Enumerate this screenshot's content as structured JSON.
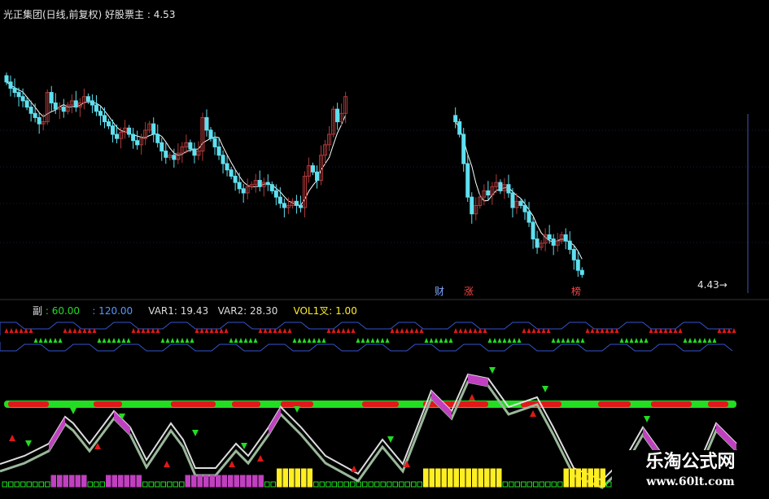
{
  "header": {
    "title": "光正集团(日线,前复权)",
    "indicator_name": "好股票主",
    "indicator_value": "4.53"
  },
  "indicator_bar": {
    "label": "副",
    "v1": ": 60.00",
    "v2": ": 120.00",
    "var1": "VAR1: 19.43",
    "var2": "VAR2: 28.30",
    "vol": "VOL1叉: 1.00"
  },
  "tags": {
    "cai": "财",
    "zhang": "涨",
    "bang": "榜"
  },
  "low_label": "4.43→",
  "watermark": {
    "title": "乐淘公式网",
    "url": "www.60lt.com"
  },
  "colors": {
    "up": "#b03a3a",
    "down": "#5fe0f0",
    "ma": "#ffffff",
    "green": "#22dd22",
    "red": "#e01818",
    "magenta": "#c040c0",
    "yellow": "#ffee22",
    "blue_line": "#3355cc",
    "accent_cyan": "#33cccc",
    "accent_blue": "#5599ff"
  },
  "chart_data": [
    {
      "type": "candlestick",
      "title": "光正集团(日线,前复权)",
      "xlabel": "",
      "ylabel": "",
      "annotation_low": 4.43,
      "gap_after_index": 83,
      "close": [
        5.45,
        5.42,
        5.4,
        5.38,
        5.36,
        5.33,
        5.3,
        5.28,
        5.25,
        5.26,
        5.4,
        5.35,
        5.32,
        5.33,
        5.31,
        5.34,
        5.36,
        5.33,
        5.35,
        5.38,
        5.36,
        5.34,
        5.31,
        5.29,
        5.26,
        5.24,
        5.2,
        5.18,
        5.21,
        5.23,
        5.2,
        5.17,
        5.15,
        5.18,
        5.22,
        5.25,
        5.2,
        5.16,
        5.12,
        5.09,
        5.1,
        5.08,
        5.11,
        5.14,
        5.16,
        5.13,
        5.1,
        5.12,
        5.28,
        5.22,
        5.18,
        5.14,
        5.1,
        5.06,
        5.03,
        5.0,
        4.97,
        4.94,
        4.92,
        4.95,
        4.96,
        4.98,
        4.95,
        4.97,
        4.96,
        4.93,
        4.9,
        4.87,
        4.85,
        4.86,
        4.88,
        4.86,
        4.85,
        5.0,
        5.05,
        5.02,
        4.98,
        5.1,
        5.15,
        5.2,
        5.32,
        5.26,
        5.3,
        5.38,
        5.26,
        5.2,
        5.06,
        4.9,
        4.82,
        4.86,
        4.9,
        4.93,
        4.91,
        4.95,
        4.97,
        4.93,
        4.96,
        4.92,
        4.85,
        4.88,
        4.86,
        4.83,
        4.78,
        4.7,
        4.66,
        4.68,
        4.72,
        4.7,
        4.67,
        4.69,
        4.72,
        4.69,
        4.65,
        4.6,
        4.55,
        4.53
      ]
    },
    {
      "type": "indicator",
      "legend": [
        "副",
        "VAR1",
        "VAR2",
        "VOL1叉"
      ],
      "var1": 19.43,
      "var2": 28.3,
      "vol1": 1.0
    }
  ]
}
